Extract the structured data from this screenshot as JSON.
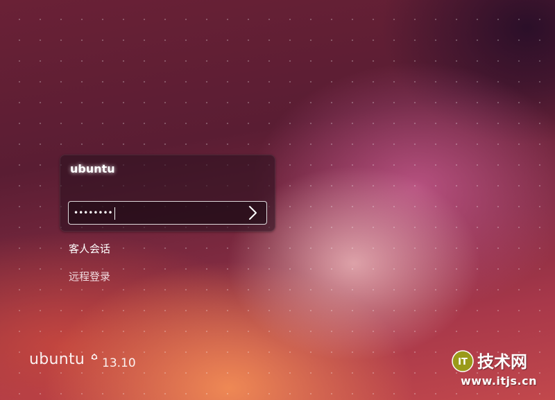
{
  "login": {
    "user_name": "ubuntu",
    "password_mask": "••••••••",
    "submit_icon": "chevron-right-icon"
  },
  "sessions": {
    "guest_label": "客人会话",
    "remote_label": "远程登录"
  },
  "branding": {
    "name": "ubuntu",
    "logo_icon": "ubuntu-circle-of-friends-icon",
    "version": "13.10"
  },
  "watermark": {
    "logo_text": "IT",
    "name": "技术网",
    "url": "www.itjs.cn"
  },
  "colors": {
    "wallpaper_base": "#6a2136",
    "wallpaper_glow": "#f28c55",
    "wallpaper_pink": "#cd5f96",
    "panel": "#2d1220"
  }
}
